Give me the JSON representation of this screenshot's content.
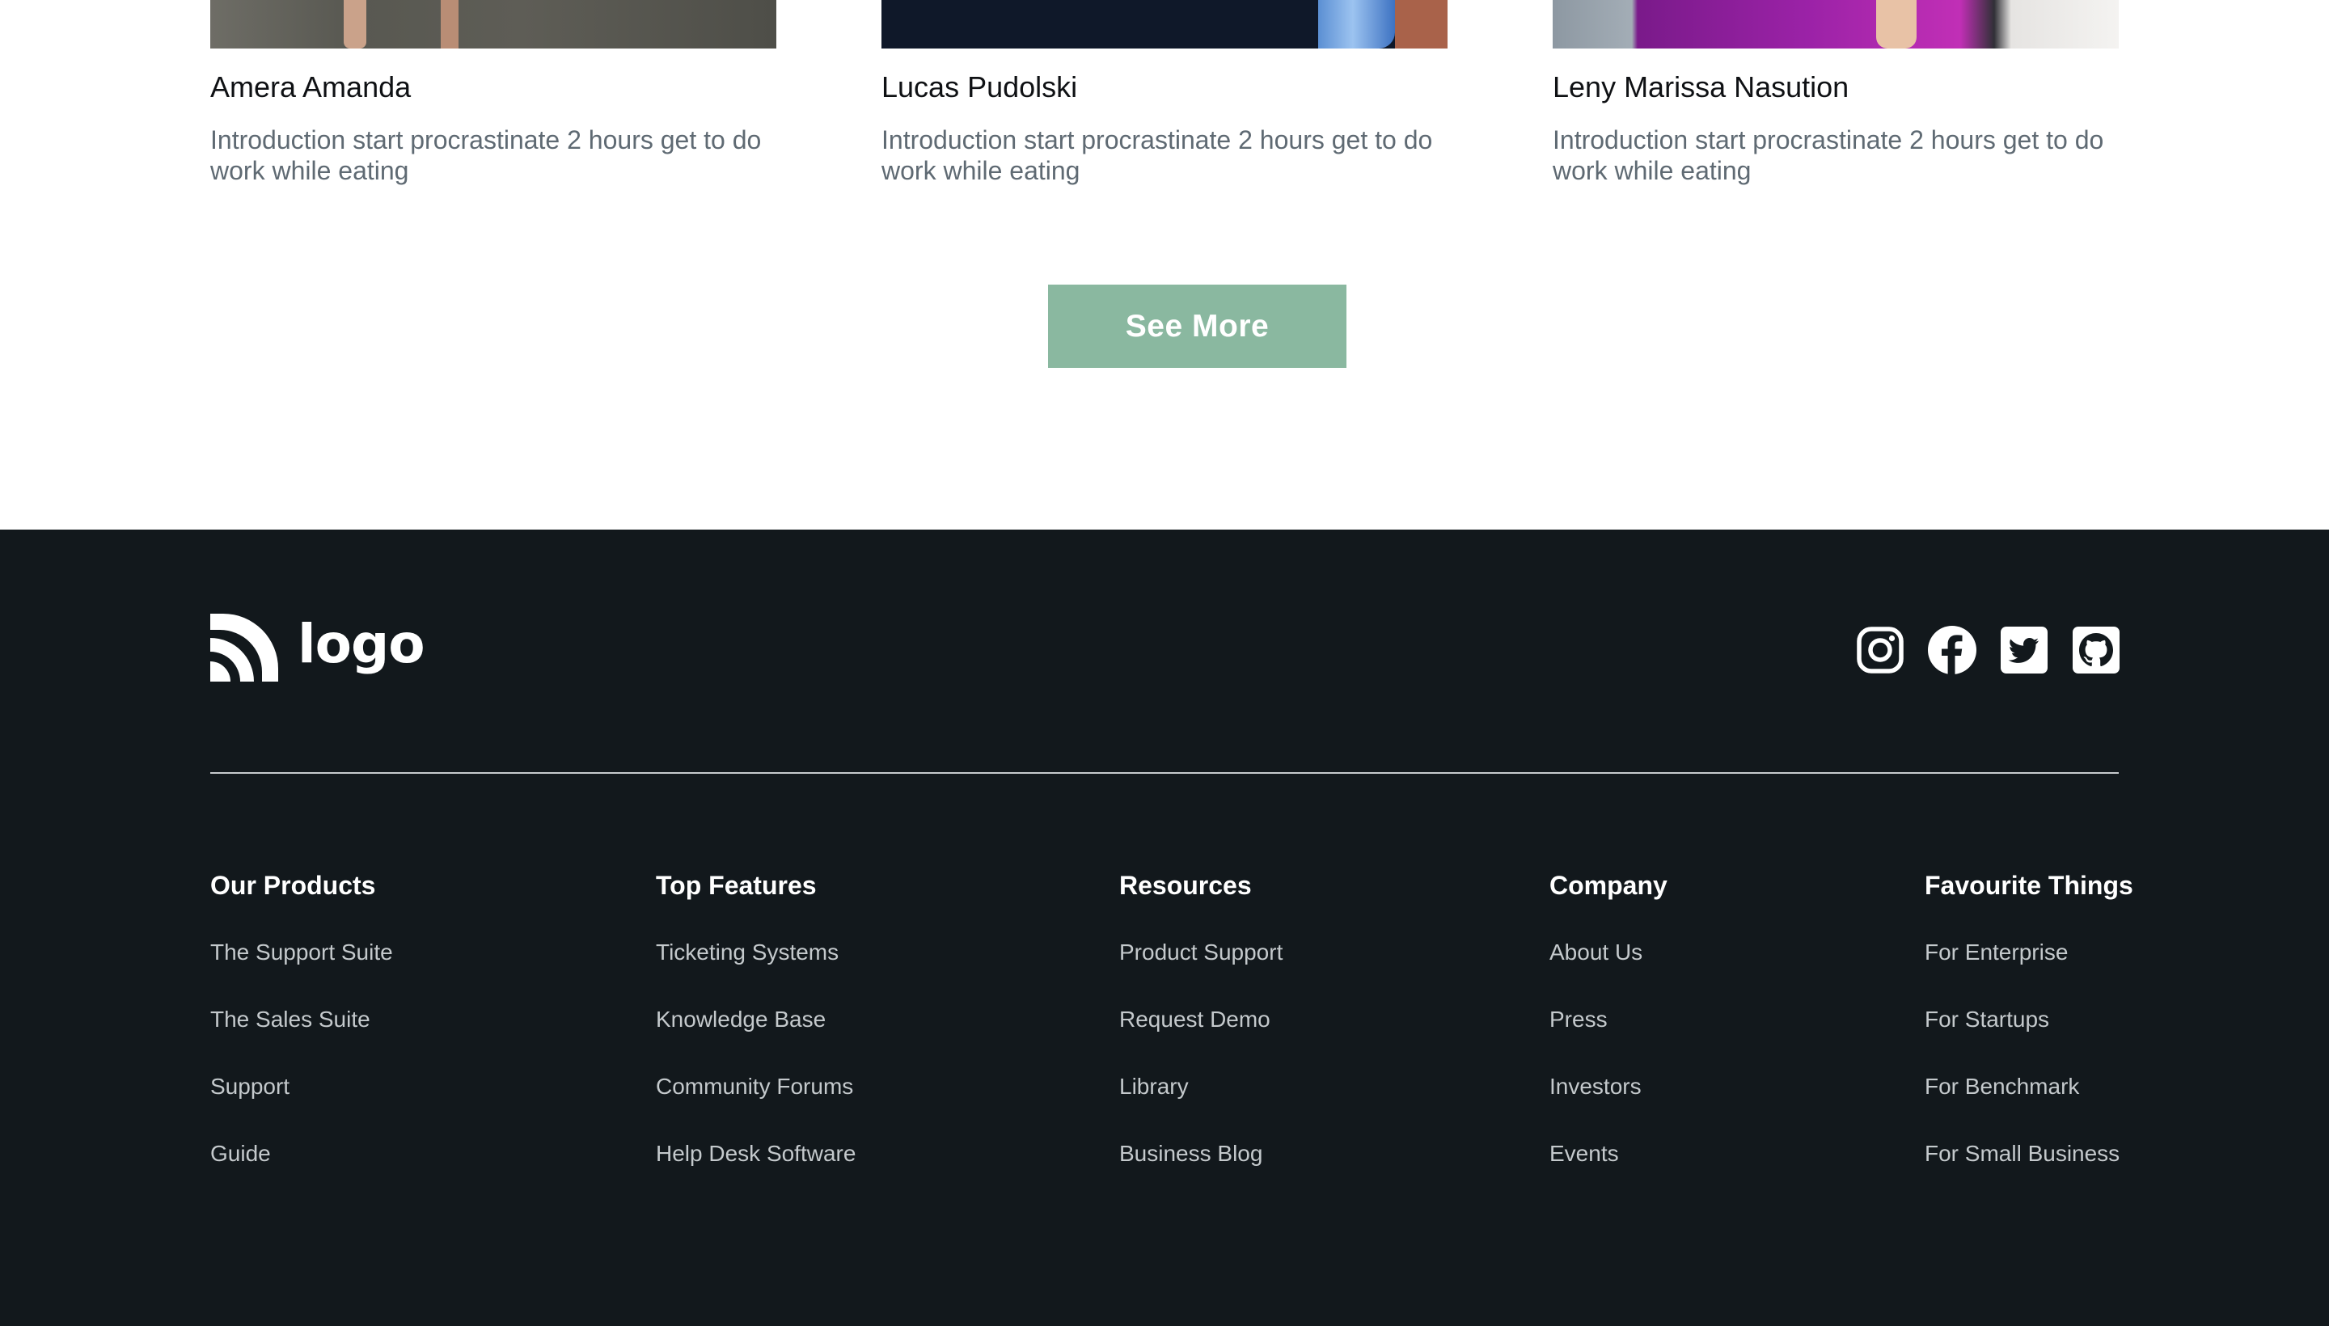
{
  "team": [
    {
      "name": "Amera Amanda",
      "description": "Introduction start procrastinate 2 hours get to do work while eating"
    },
    {
      "name": "Lucas Pudolski",
      "description": "Introduction start procrastinate 2 hours get to do work while eating"
    },
    {
      "name": "Leny Marissa Nasution",
      "description": "Introduction start procrastinate 2 hours get to do work while eating"
    }
  ],
  "see_more_label": "See More",
  "colors": {
    "button": "#8ab8a0",
    "footer_bg": "#12181c",
    "heading_text": "#ffffff",
    "link_text": "#c4c9cc",
    "description_text": "#5f6a73"
  },
  "footer": {
    "logo_text": "logo",
    "socials": [
      "instagram-icon",
      "facebook-icon",
      "twitter-icon",
      "github-icon"
    ],
    "columns": [
      {
        "title": "Our Products",
        "links": [
          "The Support Suite",
          "The Sales Suite",
          "Support",
          "Guide"
        ]
      },
      {
        "title": "Top Features",
        "links": [
          "Ticketing Systems",
          "Knowledge Base",
          "Community Forums",
          "Help Desk Software"
        ]
      },
      {
        "title": "Resources",
        "links": [
          "Product Support",
          "Request Demo",
          "Library",
          "Business Blog"
        ]
      },
      {
        "title": "Company",
        "links": [
          "About Us",
          "Press",
          "Investors",
          "Events"
        ]
      },
      {
        "title": "Favourite Things",
        "links": [
          "For Enterprise",
          "For Startups",
          "For Benchmark",
          "For Small Business"
        ]
      }
    ]
  }
}
